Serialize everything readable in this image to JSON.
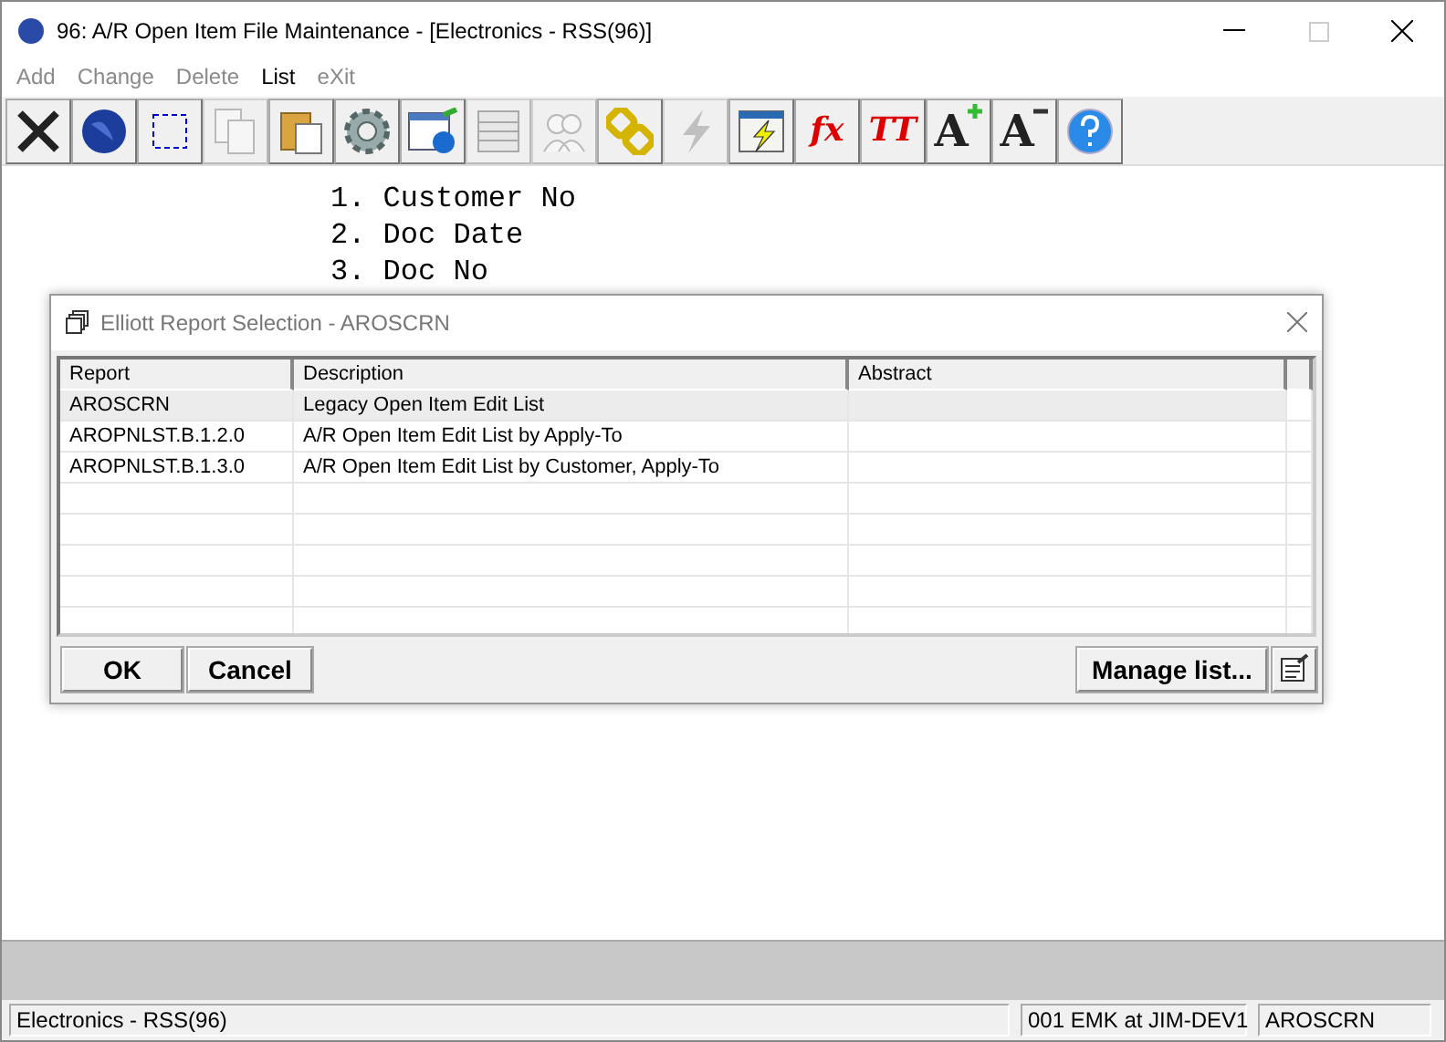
{
  "window": {
    "title": "96: A/R Open Item File Maintenance - [Electronics - RSS(96)]"
  },
  "menu": [
    {
      "label": "Add",
      "disabled": true
    },
    {
      "label": "Change",
      "disabled": true
    },
    {
      "label": "Delete",
      "disabled": true
    },
    {
      "label": "List",
      "disabled": false
    },
    {
      "label": "eXit",
      "disabled": true
    }
  ],
  "toolbar": [
    {
      "kind": "close",
      "disabled": false
    },
    {
      "kind": "globe",
      "disabled": false
    },
    {
      "kind": "select",
      "disabled": false
    },
    {
      "kind": "copy",
      "disabled": true
    },
    {
      "kind": "paste",
      "disabled": false
    },
    {
      "kind": "gear",
      "disabled": false
    },
    {
      "kind": "info",
      "disabled": false
    },
    {
      "kind": "table",
      "disabled": true
    },
    {
      "kind": "users",
      "disabled": true
    },
    {
      "kind": "chain",
      "disabled": false
    },
    {
      "kind": "bolt",
      "disabled": true
    },
    {
      "kind": "winbolt",
      "disabled": false
    },
    {
      "kind": "glyph",
      "glyph": "fx",
      "disabled": false
    },
    {
      "kind": "glyph",
      "glyph": "TT",
      "disabled": false
    },
    {
      "kind": "bigger",
      "glyph": "A",
      "disabled": false
    },
    {
      "kind": "smaller",
      "glyph": "A",
      "disabled": false
    },
    {
      "kind": "help",
      "disabled": false
    }
  ],
  "sort_options": [
    "1. Customer No",
    "2. Doc Date",
    "3. Doc No"
  ],
  "dialog": {
    "title": "Elliott Report Selection - AROSCRN",
    "columns": [
      "Report",
      "Description",
      "Abstract"
    ],
    "rows": [
      {
        "report": "AROSCRN",
        "description": "Legacy Open Item Edit List",
        "selected": true
      },
      {
        "report": "AROPNLST.B.1.2.0",
        "description": "A/R Open Item Edit List by Apply-To",
        "selected": false
      },
      {
        "report": "AROPNLST.B.1.3.0",
        "description": "A/R Open Item Edit List by Customer, Apply-To",
        "selected": false
      }
    ],
    "buttons": [
      "OK",
      "Cancel"
    ],
    "manage_button": "Manage list..."
  },
  "status_bar": [
    "Electronics - RSS(96)",
    "001 EMK at JIM-DEV1",
    "AROSCRN"
  ]
}
